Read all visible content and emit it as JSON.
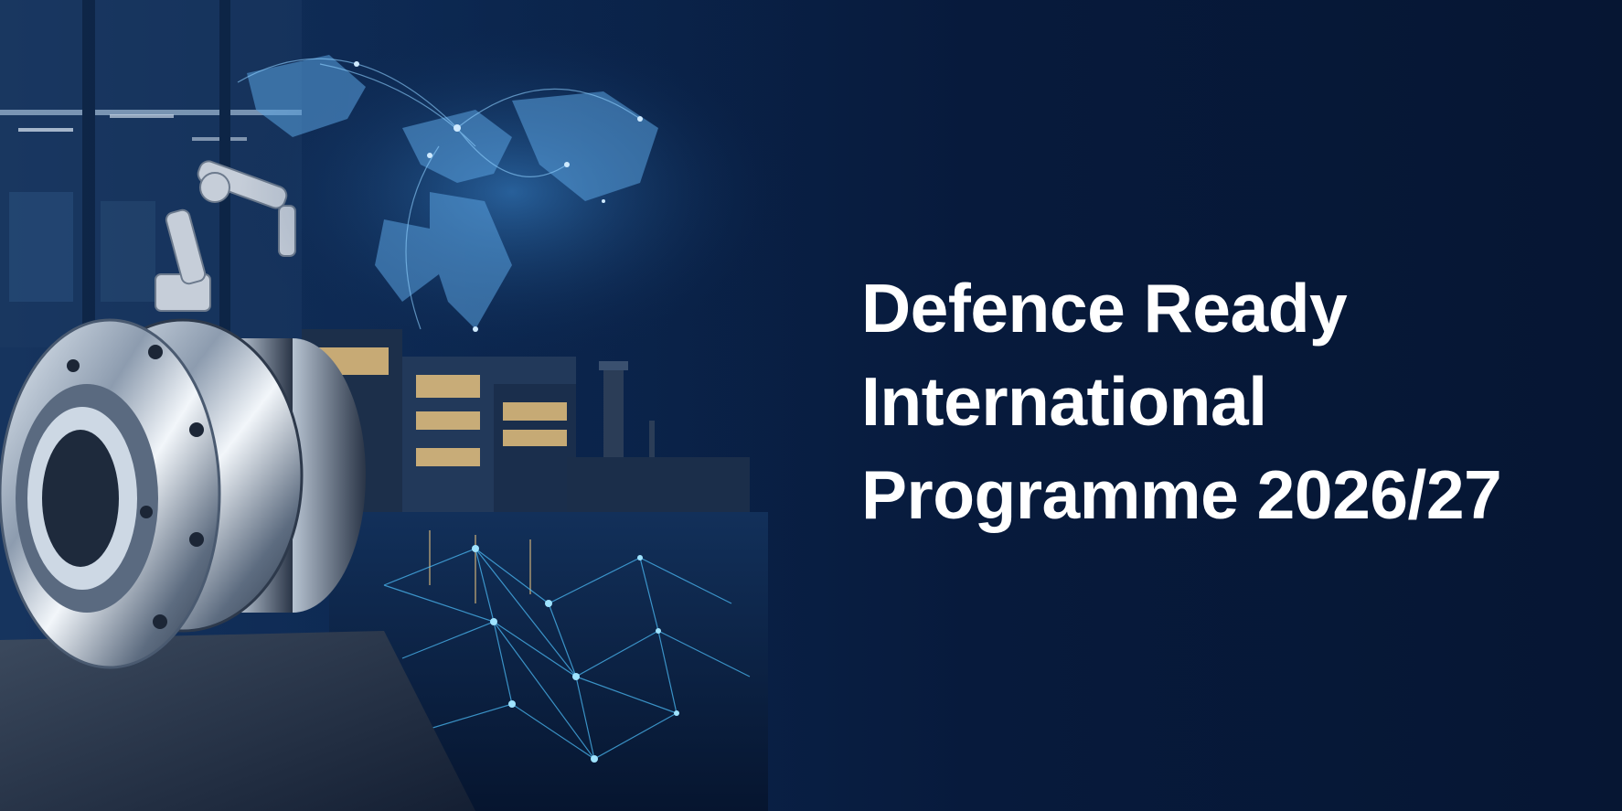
{
  "banner": {
    "title_lines": [
      "Defence Ready",
      "International",
      "Programme 2026/27"
    ]
  },
  "colors": {
    "background": "#07193a",
    "title_text": "#ffffff",
    "accent_glow": "#4fc3ff"
  },
  "illustration": {
    "elements": [
      "factory-interior",
      "robotic-arm",
      "world-map",
      "industrial-building",
      "water-reflection",
      "network-mesh",
      "steel-flange-part"
    ]
  }
}
